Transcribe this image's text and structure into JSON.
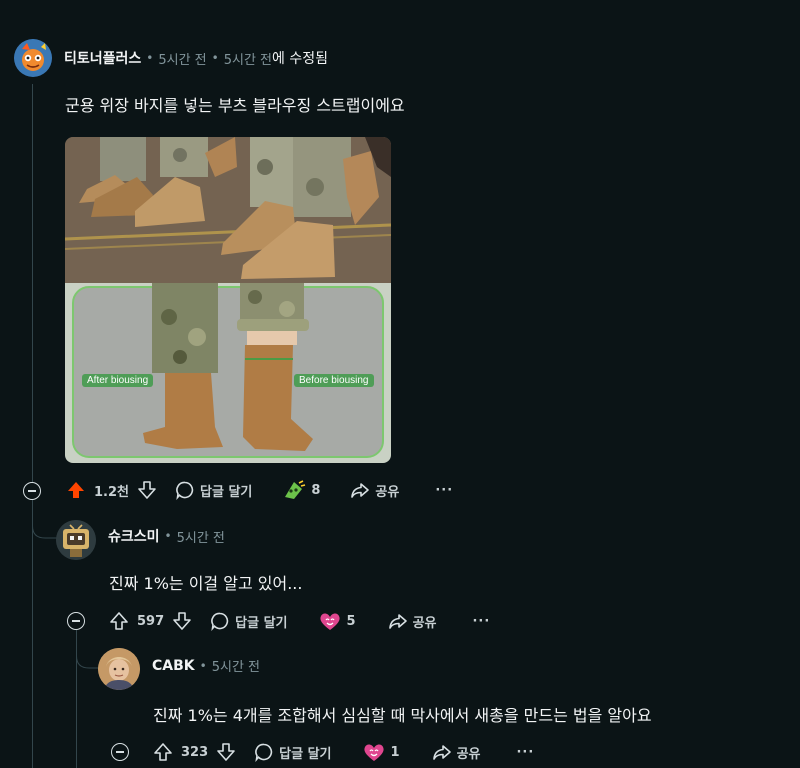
{
  "comment1": {
    "username": "티토너플러스",
    "posted_time": "5시간 전",
    "edited_time": "5시간 전",
    "edited_suffix": "에 수정됨",
    "body": "군용 위장 바지를 넣는 부츠 블라우징 스트랩이에요",
    "image": {
      "label_after": "After biousing",
      "label_before": "Before biousing"
    },
    "actions": {
      "upvotes": "1.2천",
      "reply_label": "답글 달기",
      "award_count": "8",
      "share_label": "공유",
      "more": "···"
    }
  },
  "comment2": {
    "username": "슈크스미",
    "posted_time": "5시간 전",
    "body": "진짜 1%는 이걸 알고 있어...",
    "actions": {
      "upvotes": "597",
      "reply_label": "답글 달기",
      "award_count": "5",
      "share_label": "공유",
      "more": "···"
    }
  },
  "comment3": {
    "username": "CABK",
    "posted_time": "5시간 전",
    "body": "진짜 1%는 4개를 조합해서 심심할 때 막사에서 새총을 만드는 법을 알아요",
    "actions": {
      "upvotes": "323",
      "reply_label": "답글 달기",
      "award_count": "1",
      "share_label": "공유",
      "more": "···"
    }
  },
  "colors": {
    "background": "#0b1416",
    "upvote_active": "#ff4500",
    "award_pink": "#e0468f",
    "award_green": "#6cc24a",
    "muted_text": "#82959b"
  }
}
